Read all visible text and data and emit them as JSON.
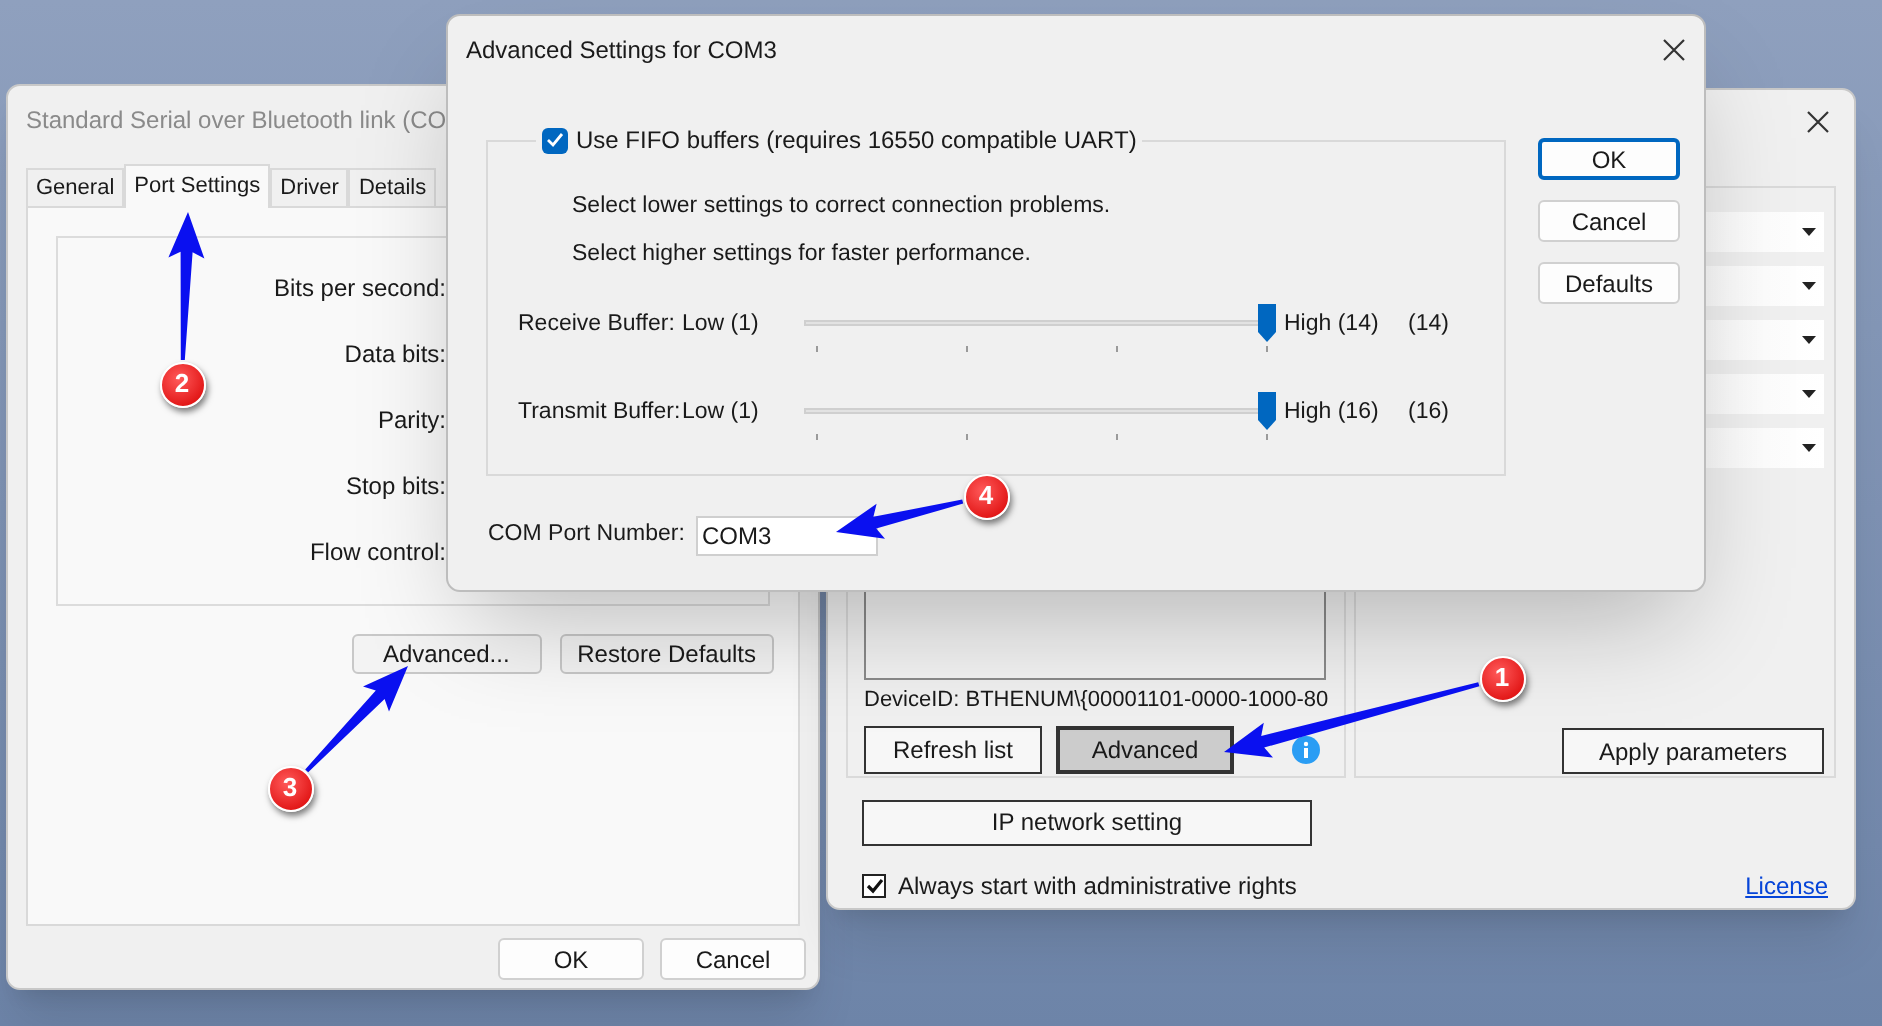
{
  "port_properties_window": {
    "title": "Standard Serial over Bluetooth link (CO",
    "tabs": [
      {
        "label": "General",
        "selected": false
      },
      {
        "label": "Port Settings",
        "selected": true
      },
      {
        "label": "Driver",
        "selected": false
      },
      {
        "label": "Details",
        "selected": false
      }
    ],
    "field_labels": [
      "Bits per second:",
      "Data bits:",
      "Parity:",
      "Stop bits:",
      "Flow control:"
    ],
    "buttons": [
      "Advanced...",
      "Restore Defaults"
    ],
    "dialog_buttons": [
      "OK",
      "Cancel"
    ]
  },
  "main_window": {
    "device_id": "DeviceID: BTHENUM\\{00001101-0000-1000-80",
    "buttons": [
      {
        "label": "Refresh list",
        "pressed": false
      },
      {
        "label": "Advanced",
        "pressed": true
      }
    ],
    "apply_button": "Apply parameters",
    "ip_button": "IP network setting",
    "admin_checkbox": {
      "label": "Always start with administrative rights",
      "checked": true
    },
    "license_link": "License"
  },
  "advanced_dialog": {
    "title": "Advanced Settings for COM3",
    "fifo": {
      "label": "Use FIFO buffers (requires 16550 compatible UART)",
      "checked": true
    },
    "hints": [
      "Select lower settings to correct connection problems.",
      "Select higher settings for faster performance."
    ],
    "buffers": [
      {
        "name": "Receive Buffer:",
        "low": "Low (1)",
        "high": "High (14)",
        "reading": "(14)",
        "level": 1
      },
      {
        "name": "Transmit Buffer:",
        "low": "Low (1)",
        "high": "High (16)",
        "reading": "(16)",
        "level": 1
      }
    ],
    "com_port": {
      "label": "COM Port Number:",
      "value": "COM3"
    },
    "buttons": [
      {
        "label": "OK",
        "default": true
      },
      {
        "label": "Cancel",
        "default": false
      },
      {
        "label": "Defaults",
        "default": false
      }
    ]
  },
  "annotations": [
    {
      "label": "1"
    },
    {
      "label": "2"
    },
    {
      "label": "3"
    },
    {
      "label": "4"
    }
  ]
}
